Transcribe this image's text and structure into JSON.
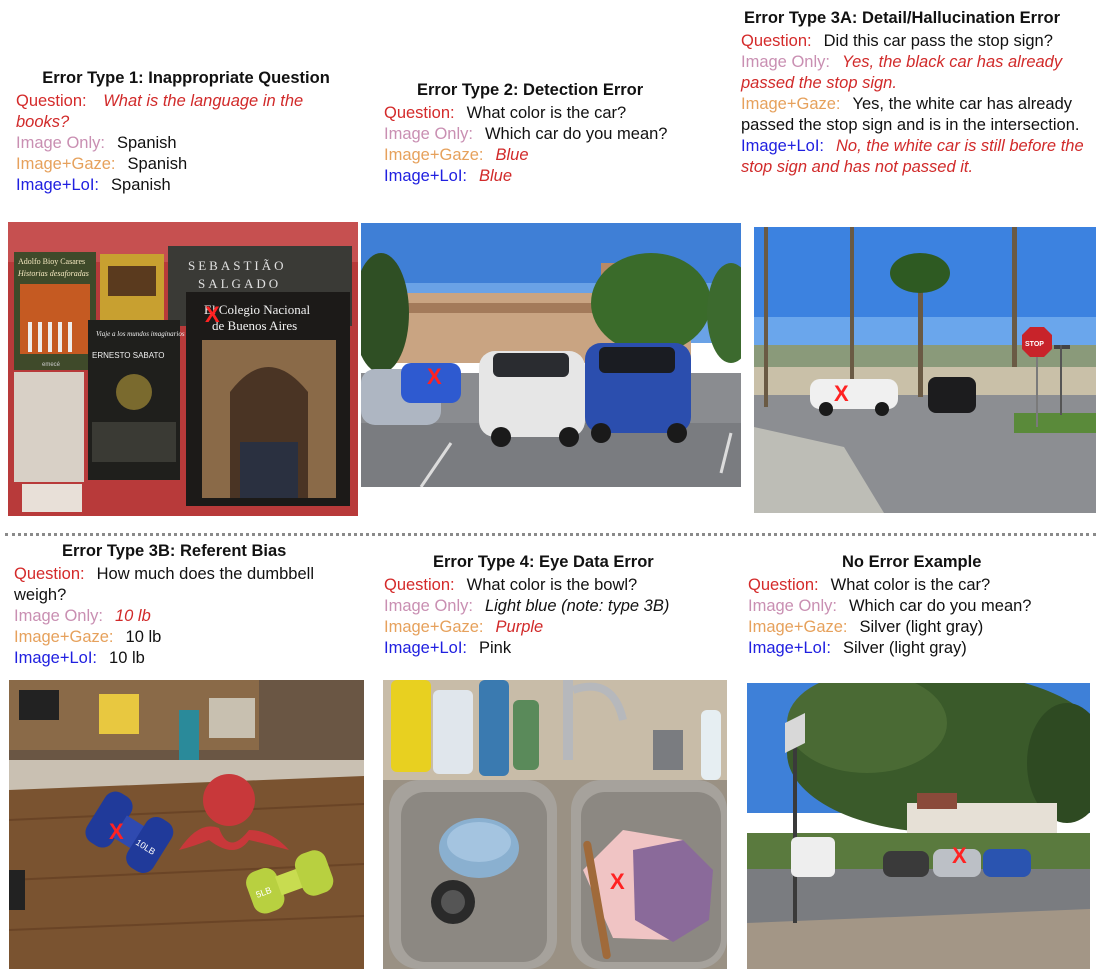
{
  "panels": [
    {
      "title": "Error Type 1: Inappropriate Question",
      "question_label": "Question:",
      "question": "What is the language in the books?",
      "image_only_label": "Image Only:",
      "image_only": "Spanish",
      "image_gaze_label": "Image+Gaze:",
      "image_gaze": "Spanish",
      "image_lol_label": "Image+LoI:",
      "image_lol": "Spanish"
    },
    {
      "title": "Error Type 2: Detection Error",
      "question_label": "Question:",
      "question": "What color is the car?",
      "image_only_label": "Image Only:",
      "image_only": "Which car do you mean?",
      "image_gaze_label": "Image+Gaze:",
      "image_gaze": "Blue",
      "image_lol_label": "Image+LoI:",
      "image_lol": "Blue"
    },
    {
      "title": "Error Type 3A: Detail/Hallucination Error",
      "question_label": "Question:",
      "question": "Did this car pass the stop sign?",
      "image_only_label": "Image Only:",
      "image_only": "Yes, the black car has already passed the stop sign.",
      "image_gaze_label": "Image+Gaze:",
      "image_gaze": "Yes, the white car has already passed the stop sign and is in the intersection.",
      "image_lol_label": "Image+LoI:",
      "image_lol": "No, the white car is still before the stop sign and has not passed it."
    },
    {
      "title": "Error Type 3B: Referent Bias",
      "question_label": "Question:",
      "question": "How much does the dumbbell weigh?",
      "image_only_label": "Image Only:",
      "image_only": "10 lb",
      "image_gaze_label": "Image+Gaze:",
      "image_gaze": "10 lb",
      "image_lol_label": "Image+LoI:",
      "image_lol": "10 lb"
    },
    {
      "title": "Error Type 4: Eye Data Error",
      "question_label": "Question:",
      "question": "What color is the bowl?",
      "image_only_label": "Image Only:",
      "image_only": "Light blue (note: type 3B)",
      "image_gaze_label": "Image+Gaze:",
      "image_gaze": "Purple",
      "image_lol_label": "Image+LoI:",
      "image_lol": "Pink"
    },
    {
      "title": "No Error Example",
      "question_label": "Question:",
      "question": "What color is the car?",
      "image_only_label": "Image Only:",
      "image_only": "Which car do you mean?",
      "image_gaze_label": "Image+Gaze:",
      "image_gaze": "Silver (light gray)",
      "image_lol_label": "Image+LoI:",
      "image_lol": "Silver (light gray)"
    }
  ],
  "photo_texts": {
    "book1_author": "Adolfo Bioy Casares",
    "book1_title": "Historias desaforadas",
    "book1_publisher": "emecé",
    "book2_author": "SEBASTIÃO",
    "book2_author2": "SALGADO",
    "book3_title": "Viaje a los mundos imaginarios",
    "book3_author": "ERNESTO SABATO",
    "book4_title": "El Colegio Nacional de Buenos Aires",
    "dumbbell_blue_text": "10LB",
    "dumbbell_green_text": "5LB",
    "stop_sign": "STOP"
  },
  "marker": "X",
  "colors": {
    "question_label": "#d42a2a",
    "image_only_label": "#c98fb2",
    "image_gaze_label": "#e6a15c",
    "image_lol_label": "#2020e0",
    "error_text": "#d12a2a",
    "marker": "#ff2222"
  }
}
